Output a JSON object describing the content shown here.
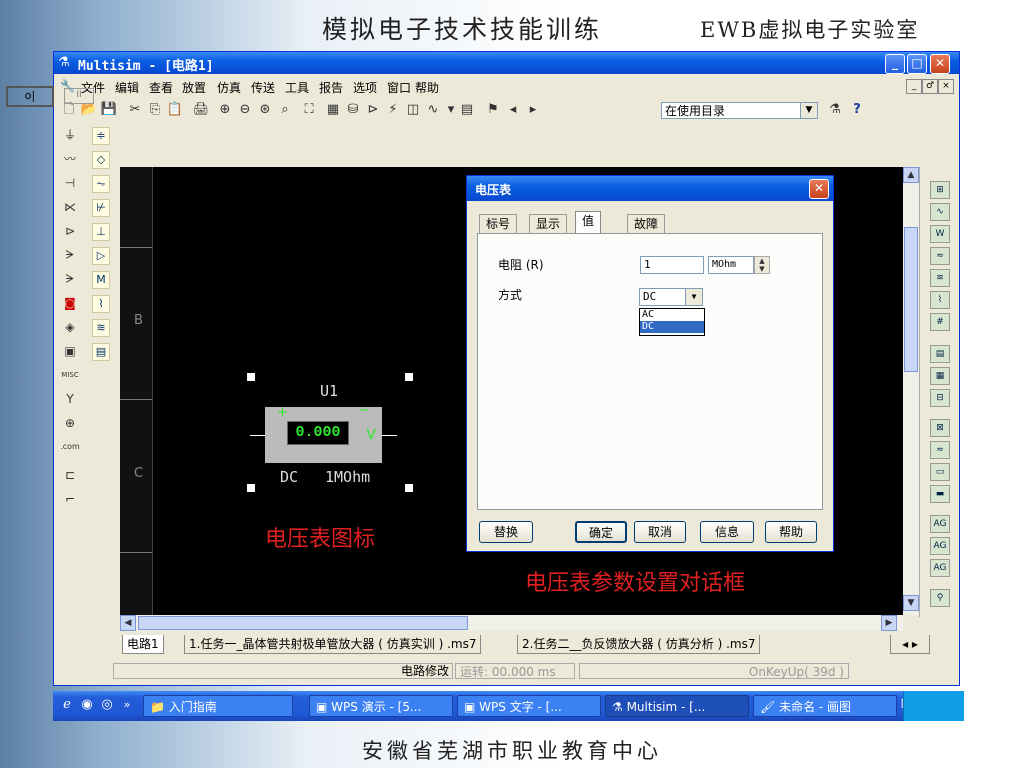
{
  "slide": {
    "title": "模拟电子技术技能训练",
    "subtitle": "EWB虚拟电子实验室",
    "footer": "安徽省芜湖市职业教育中心"
  },
  "window": {
    "title": "Multisim - [电路1]",
    "minimize_label": "_",
    "maximize_label": "□",
    "close_label": "✕"
  },
  "menu": {
    "items": [
      "文件",
      "编辑",
      "查看",
      "放置",
      "仿真",
      "传送",
      "工具",
      "报告",
      "选项",
      "窗口",
      "帮助"
    ],
    "mdi": [
      "_",
      "♂",
      "×"
    ]
  },
  "toolbar": {
    "combo_value": "在使用目录",
    "help_label": "?"
  },
  "toolbar2": {
    "run_label": "o|",
    "pause_label": "II"
  },
  "canvas": {
    "row_labels": [
      "B",
      "C"
    ],
    "part_ref": "U1",
    "meter_value": "0.000",
    "meter_unit": "V",
    "meter_plus": "+",
    "meter_minus": "−",
    "meter_mode": "DC",
    "meter_resistance": "1MOhm",
    "annotation_icon": "电压表图标",
    "annotation_dialog": "电压表参数设置对话框"
  },
  "dialog": {
    "title": "电压表",
    "close_label": "✕",
    "tabs": [
      "标号",
      "显示",
      "值",
      "故障"
    ],
    "active_tab": "值",
    "resistance_label": "电阻 (R)",
    "resistance_value": "1",
    "resistance_unit": "MOhm",
    "mode_label": "方式",
    "mode_value": "DC",
    "mode_options": [
      "AC",
      "DC"
    ],
    "buttons": [
      "替换",
      "确定",
      "取消",
      "信息",
      "帮助"
    ]
  },
  "file_tabs": [
    "电路1",
    "1.任务一_晶体管共射极单管放大器 ( 仿真实训 ) .ms7",
    "2.任务二__负反馈放大器 ( 仿真分析 ) .ms7"
  ],
  "status": {
    "modified": "电路修改",
    "run_time": "运转: 00.000 ms",
    "event": "OnKeyUp( 39d )"
  },
  "taskbar": {
    "quick_launch_more": "»",
    "items": [
      "入门指南",
      "WPS 演示 - [5...",
      "WPS 文字 - [...",
      "Multisim - [...",
      "未命名 - 画图"
    ]
  },
  "colors": {
    "xp_blue": "#0a5fe3",
    "canvas_bg": "#000000",
    "meter_green": "#2eea2e",
    "annotation_red": "#e02020"
  }
}
